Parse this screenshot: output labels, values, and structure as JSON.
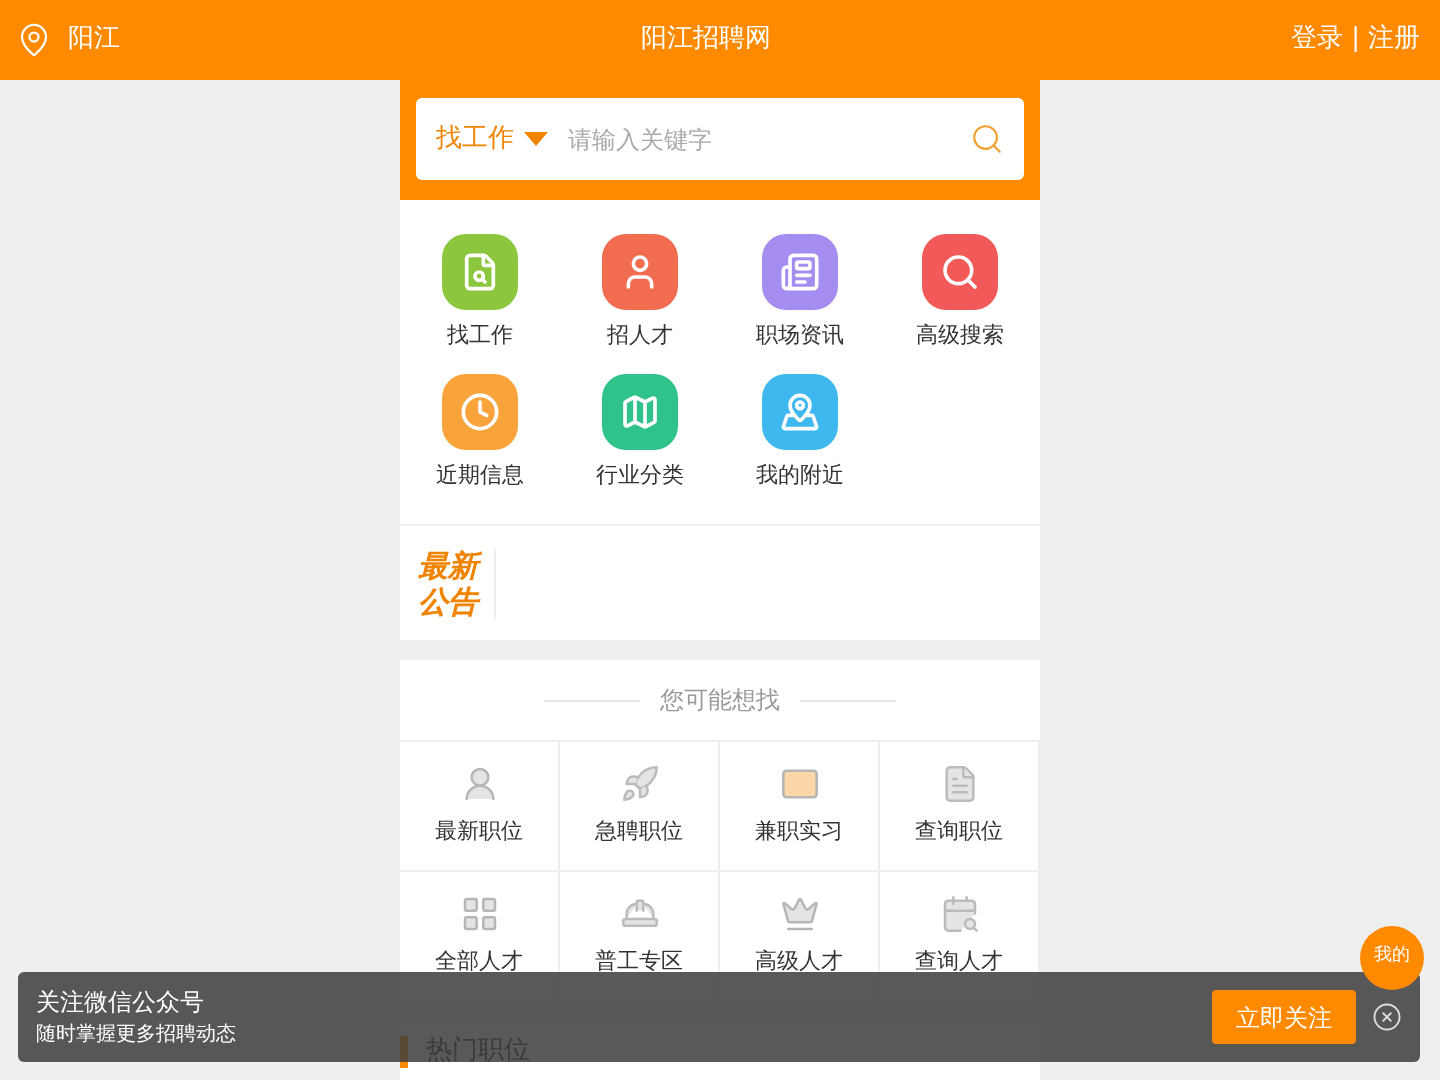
{
  "header": {
    "location": "阳江",
    "title": "阳江招聘网",
    "login": "登录",
    "separator": "|",
    "register": "注册"
  },
  "search": {
    "category": "找工作",
    "placeholder": "请输入关键字"
  },
  "quick_links": [
    {
      "label": "找工作",
      "color": "#8cc63f"
    },
    {
      "label": "招人才",
      "color": "#f26c4f"
    },
    {
      "label": "职场资讯",
      "color": "#a48cf0"
    },
    {
      "label": "高级搜索",
      "color": "#f25a5a"
    },
    {
      "label": "近期信息",
      "color": "#f9a43a"
    },
    {
      "label": "行业分类",
      "color": "#2fc28a"
    },
    {
      "label": "我的附近",
      "color": "#3fb8ef"
    }
  ],
  "notice": {
    "badge_top": "最新",
    "badge_bottom": "公告"
  },
  "suggestions": {
    "title": "您可能想找",
    "items": [
      "最新职位",
      "急聘职位",
      "兼职实习",
      "查询职位",
      "全部人才",
      "普工专区",
      "高级人才",
      "查询人才"
    ]
  },
  "hot": {
    "title": "热门职位"
  },
  "float_button": "我的",
  "follow_bar": {
    "title": "关注微信公众号",
    "subtitle": "随时掌握更多招聘动态",
    "button": "立即关注"
  }
}
